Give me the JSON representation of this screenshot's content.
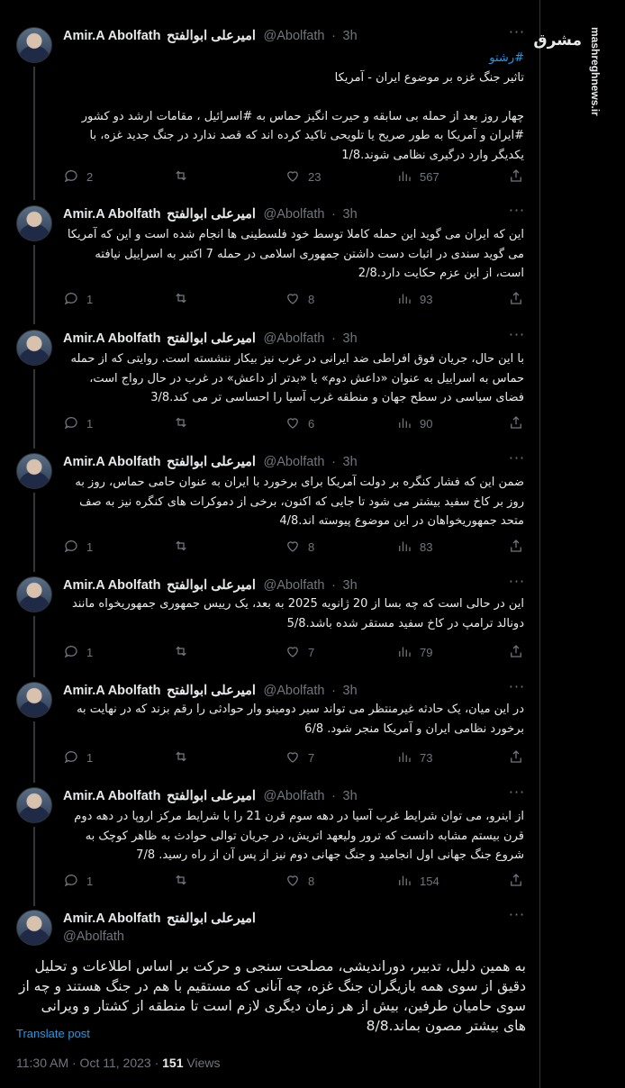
{
  "author": {
    "name": "Amir.A Abolfath",
    "name_fa": "امیرعلی ابوالفتح",
    "handle": "@Abolfath",
    "time": "3h"
  },
  "tweets": [
    {
      "lines": [
        "#رشتو",
        "تاثیر جنگ غزه بر موضوع ایران - آمریکا",
        "",
        "چهار روز بعد از حمله بی سابقه و حیرت انگیز حماس به #اسرائیل ، مقامات ارشد دو کشور #ایران و آمریکا به طور صریح یا تلویحی تاکید کرده اند که قصد ندارد در جنگ جدید غزه، با یکدیگر وارد درگیری نظامی شوند.1/8"
      ],
      "replies": "2",
      "retweets": "",
      "likes": "23",
      "views": "567"
    },
    {
      "lines": [
        "این که ایران می گوید این حمله کاملا توسط خود فلسطینی ها انجام شده است و این که آمریکا می گوید سندی در اثبات دست داشتن جمهوری اسلامی در حمله 7 اکتبر به اسراییل نیافته است، از این عزم حکایت دارد.2/8"
      ],
      "replies": "1",
      "retweets": "",
      "likes": "8",
      "views": "93"
    },
    {
      "lines": [
        "با این حال، جریان فوق افراطی ضد ایرانی در غرب نیز بیکار ننشسته است. روایتی که از حمله حماس به اسراییل به عنوان «داعش دوم» یا «بدتر از داعش» در غرب در حال رواج است، فضای سیاسی در سطح جهان و منطقه غرب آسیا را احساسی تر می کند.3/8"
      ],
      "replies": "1",
      "retweets": "",
      "likes": "6",
      "views": "90"
    },
    {
      "lines": [
        "ضمن این که فشار کنگره بر دولت آمریکا برای برخورد با ایران به عنوان حامی حماس، روز به روز بر کاخ سفید بیشتر می شود تا جایی که اکنون، برخی از دموکرات های کنگره نیز به صف متحد جمهوریخواهان در این موضوع پیوسته اند.4/8"
      ],
      "replies": "1",
      "retweets": "",
      "likes": "8",
      "views": "83"
    },
    {
      "lines": [
        "این در حالی است که چه بسا از 20 ژانویه 2025 به بعد، یک رییس جمهوری جمهوریخواه مانند دونالد ترامپ در کاخ سفید مستقر شده باشد.5/8"
      ],
      "replies": "1",
      "retweets": "",
      "likes": "7",
      "views": "79"
    },
    {
      "lines": [
        "در این میان، یک حادثه غیرمنتظر می تواند سیر دومینو وار حوادثی را رقم بزند که در نهایت به برخورد نظامی ایران و آمریکا منجر شود. 6/8"
      ],
      "replies": "1",
      "retweets": "",
      "likes": "7",
      "views": "73"
    },
    {
      "lines": [
        "از اینرو، می توان شرایط غرب آسیا در دهه سوم قرن 21 را با شرایط مرکز اروپا در دهه دوم قرن بیستم مشابه دانست که ترور ولیعهد اتریش، در جریان توالی حوادث به ظاهر کوچک به شروع جنگ جهانی اول انجامید و جنگ جهانی دوم نیز از پس آن از راه رسید. 7/8"
      ],
      "replies": "1",
      "retweets": "",
      "likes": "8",
      "views": "154"
    }
  ],
  "main_tweet": {
    "text": "به همین دلیل، تدبیر، دوراندیشی، مصلحت سنجی و حرکت بر اساس اطلاعات و تحلیل دقیق از سوی همه بازیگران جنگ غزه، چه آنانی که مستقیم با هم در جنگ هستند و چه از سوی حامیان طرفین، بیش از هر زمان دیگری لازم است تا منطقه از کشتار و ویرانی های بیشتر مصون بماند.8/8",
    "translate_label": "Translate post",
    "timestamp": "11:30 AM · Oct 11, 2023 · ",
    "views_count": "151",
    "views_label": " Views"
  },
  "watermark": {
    "logo": "مشرق",
    "site": "mashreghnews.ir"
  },
  "icons": [
    "more-icon",
    "reply-icon",
    "retweet-icon",
    "like-icon",
    "views-icon",
    "share-icon"
  ],
  "colors": {
    "background": "#000000",
    "text": "#e7e9ea",
    "muted": "#71767b",
    "link": "#1d9bf0"
  }
}
